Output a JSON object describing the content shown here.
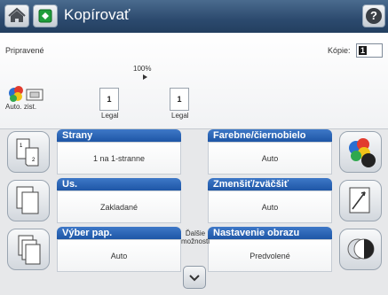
{
  "header": {
    "title": "Kopírovať",
    "home_icon": "home-icon",
    "app_icon": "copy-app-icon",
    "help_icon": "help-icon",
    "help_glyph": "?"
  },
  "status": {
    "text": "Pripravené",
    "copies_label": "Kópie:",
    "copies_value": "1",
    "zoom": "100%",
    "original_number": "1",
    "original_size": "Legal",
    "output_number": "1",
    "output_size": "Legal",
    "auto_store_label": "Auto. zist."
  },
  "tiles": {
    "sides": {
      "title": "Strany",
      "value": "1 na 1-stranne",
      "icon": "sides-icon"
    },
    "color": {
      "title": "Farebne/čiernobielo",
      "value": "Auto",
      "icon": "color-icon"
    },
    "content": {
      "title": "Us.",
      "value": "Zakladané",
      "icon": "content-orientation-icon"
    },
    "reduce": {
      "title": "Zmenšiť/zväčšiť",
      "value": "Auto",
      "icon": "reduce-enlarge-icon"
    },
    "paper": {
      "title": "Výber pap.",
      "value": "Auto",
      "icon": "paper-select-icon"
    },
    "image": {
      "title": "Nastavenie obrazu",
      "value": "Predvolené",
      "icon": "image-adjust-icon"
    }
  },
  "more_options": {
    "label_line1": "Ďalšie",
    "label_line2": "možnosti",
    "icon": "chevron-down-icon"
  },
  "colors": {
    "header": "#2c4a6e",
    "tile_bar": "#2a66b8",
    "app_icon": "#1f9e3a"
  }
}
